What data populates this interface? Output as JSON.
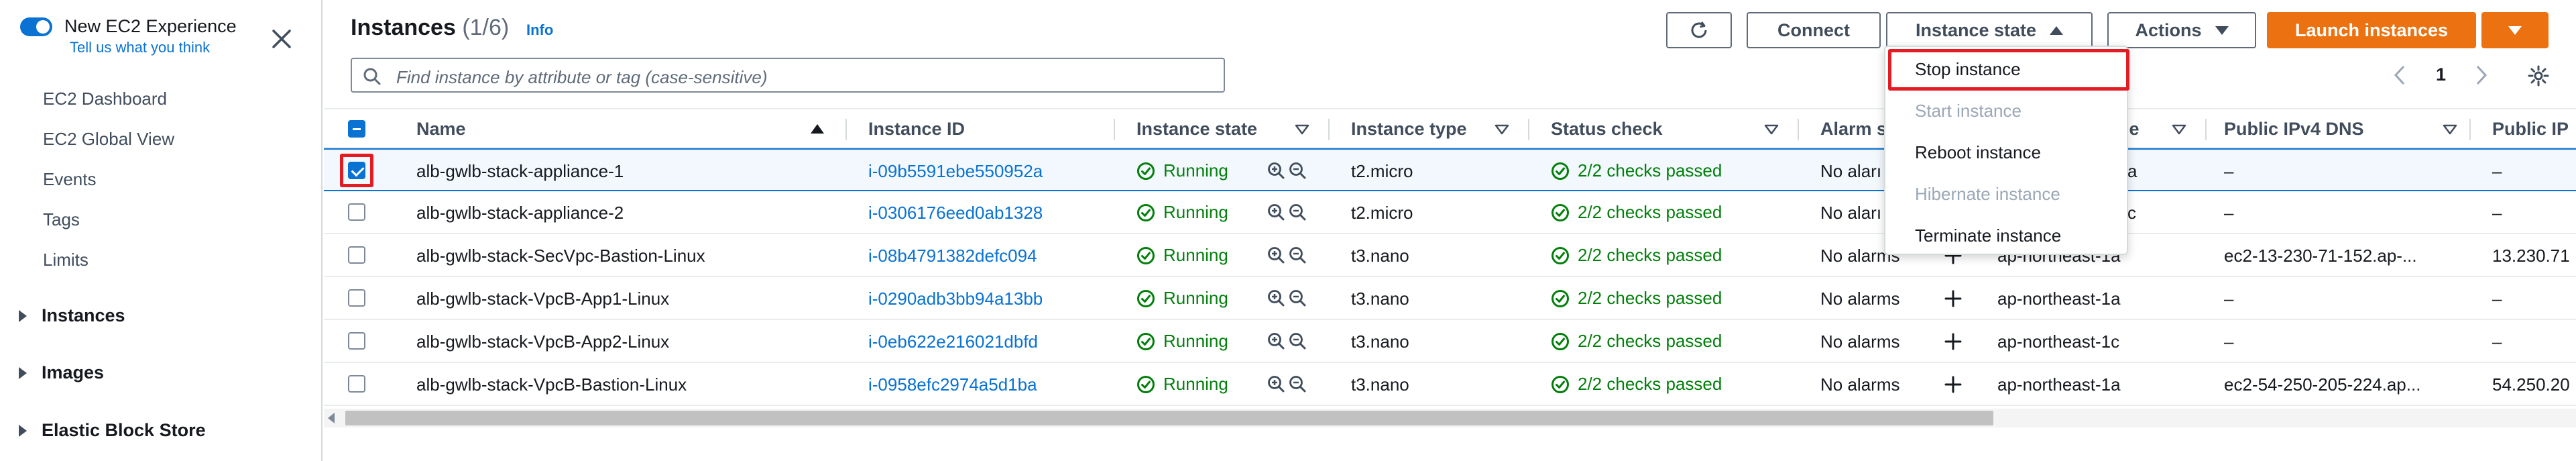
{
  "sidebar": {
    "experience_title": "New EC2 Experience",
    "experience_link": "Tell us what you think",
    "items": [
      {
        "label": "EC2 Dashboard"
      },
      {
        "label": "EC2 Global View"
      },
      {
        "label": "Events"
      },
      {
        "label": "Tags"
      },
      {
        "label": "Limits"
      }
    ],
    "sections": [
      {
        "label": "Instances"
      },
      {
        "label": "Images"
      },
      {
        "label": "Elastic Block Store"
      }
    ]
  },
  "header": {
    "title": "Instances",
    "count": "(1/6)",
    "info": "Info",
    "buttons": {
      "connect": "Connect",
      "instance_state": "Instance state",
      "actions": "Actions",
      "launch": "Launch instances"
    }
  },
  "search": {
    "placeholder": "Find instance by attribute or tag (case-sensitive)"
  },
  "pagination": {
    "page": "1"
  },
  "table": {
    "columns": [
      {
        "label": "Name"
      },
      {
        "label": "Instance ID"
      },
      {
        "label": "Instance state"
      },
      {
        "label": "Instance type"
      },
      {
        "label": "Status check"
      },
      {
        "label": "Alarm s"
      },
      {
        "label": "ne"
      },
      {
        "label": "Public IPv4 DNS"
      },
      {
        "label": "Public IP"
      }
    ],
    "rows": [
      {
        "name": "alb-gwlb-stack-appliance-1",
        "id": "i-09b5591ebe550952a",
        "state": "Running",
        "type": "t2.micro",
        "status": "2/2 checks passed",
        "alarm": "No aları",
        "az": "a",
        "dns": "–",
        "ip": "–",
        "selected": true
      },
      {
        "name": "alb-gwlb-stack-appliance-2",
        "id": "i-0306176eed0ab1328",
        "state": "Running",
        "type": "t2.micro",
        "status": "2/2 checks passed",
        "alarm": "No aları",
        "az": "c",
        "dns": "–",
        "ip": "–",
        "selected": false
      },
      {
        "name": "alb-gwlb-stack-SecVpc-Bastion-Linux",
        "id": "i-08b4791382defc094",
        "state": "Running",
        "type": "t3.nano",
        "status": "2/2 checks passed",
        "alarm": "No alarms",
        "az": "ap-northeast-1a",
        "dns": "ec2-13-230-71-152.ap-...",
        "ip": "13.230.71",
        "selected": false
      },
      {
        "name": "alb-gwlb-stack-VpcB-App1-Linux",
        "id": "i-0290adb3bb94a13bb",
        "state": "Running",
        "type": "t3.nano",
        "status": "2/2 checks passed",
        "alarm": "No alarms",
        "az": "ap-northeast-1a",
        "dns": "–",
        "ip": "–",
        "selected": false
      },
      {
        "name": "alb-gwlb-stack-VpcB-App2-Linux",
        "id": "i-0eb622e216021dbfd",
        "state": "Running",
        "type": "t3.nano",
        "status": "2/2 checks passed",
        "alarm": "No alarms",
        "az": "ap-northeast-1c",
        "dns": "–",
        "ip": "–",
        "selected": false
      },
      {
        "name": "alb-gwlb-stack-VpcB-Bastion-Linux",
        "id": "i-0958efc2974a5d1ba",
        "state": "Running",
        "type": "t3.nano",
        "status": "2/2 checks passed",
        "alarm": "No alarms",
        "az": "ap-northeast-1a",
        "dns": "ec2-54-250-205-224.ap...",
        "ip": "54.250.20",
        "selected": false
      }
    ]
  },
  "menu": {
    "items": [
      {
        "label": "Stop instance",
        "disabled": false
      },
      {
        "label": "Start instance",
        "disabled": true
      },
      {
        "label": "Reboot instance",
        "disabled": false
      },
      {
        "label": "Hibernate instance",
        "disabled": true
      },
      {
        "label": "Terminate instance",
        "disabled": false
      }
    ]
  },
  "colors": {
    "accent": "#0972d3",
    "running": "#037f0c",
    "launch": "#ec7211",
    "highlight": "#e31b23"
  },
  "icons": [
    "toggle-icon",
    "close-icon",
    "refresh-icon",
    "search-icon",
    "settings-icon",
    "zoom-in-icon",
    "zoom-out-icon",
    "check-circle-icon",
    "plus-icon"
  ]
}
